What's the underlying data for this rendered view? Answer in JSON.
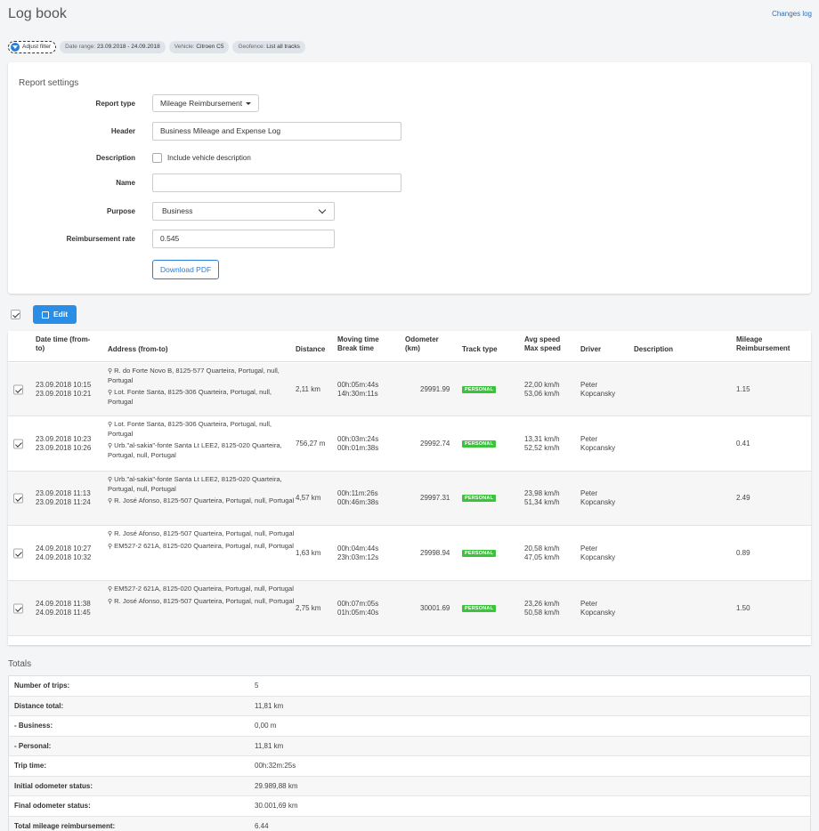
{
  "page": {
    "title": "Log book",
    "changes_log": "Changes log"
  },
  "filters": {
    "adjust": "Adjust filter",
    "date_range_label": "Date range: ",
    "date_range_value": "23.09.2018 - 24.09.2018",
    "vehicle_label": "Vehicle: ",
    "vehicle_value": "Citroen C5",
    "geofence_label": "Geofence: ",
    "geofence_value": "List all tracks"
  },
  "settings": {
    "title": "Report settings",
    "report_type_label": "Report type",
    "report_type_value": "Mileage Reimbursement",
    "header_label": "Header",
    "header_value": "Business Mileage and Expense Log",
    "description_label": "Description",
    "description_checkbox": "Include vehicle description",
    "name_label": "Name",
    "name_value": "",
    "purpose_label": "Purpose",
    "purpose_value": "Business",
    "rate_label": "Reimbursement rate",
    "rate_value": "0.545",
    "download": "Download PDF"
  },
  "toolbar": {
    "edit": "Edit"
  },
  "table": {
    "headers": {
      "date1": "Date time (from-",
      "date2": "to)",
      "address": "Address (from-to)",
      "distance": "Distance",
      "moving1": "Moving time",
      "moving2": "Break time",
      "odo1": "Odometer",
      "odo2": "(km)",
      "track": "Track type",
      "speed1": "Avg speed",
      "speed2": "Max speed",
      "driver": "Driver",
      "description": "Description",
      "mr1": "Mileage",
      "mr2": "Reimbursement"
    },
    "rows": [
      {
        "d1": "23.09.2018 10:15",
        "d2": "23.09.2018 10:21",
        "from": "R. do Forte Novo B, 8125-577 Quarteira, Portugal, null, Portugal",
        "to": "Lot. Fonte Santa, 8125-306 Quarteira, Portugal, null, Portugal",
        "distance": "2,11 km",
        "moving": "00h:05m:44s",
        "break": "14h:30m:11s",
        "odometer": "29991.99",
        "track": "PERSONAL",
        "avg": "22,00 km/h",
        "max": "53,06 km/h",
        "driver1": "Peter",
        "driver2": "Kopcansky",
        "description": "",
        "mr": "1.15"
      },
      {
        "d1": "23.09.2018 10:23",
        "d2": "23.09.2018 10:26",
        "from": "Lot. Fonte Santa, 8125-306 Quarteira, Portugal, null, Portugal",
        "to": "Urb.\"al-sakia\"-fonte Santa Lt LEE2, 8125-020 Quarteira, Portugal, null, Portugal",
        "distance": "756,27 m",
        "moving": "00h:03m:24s",
        "break": "00h:01m:38s",
        "odometer": "29992.74",
        "track": "PERSONAL",
        "avg": "13,31 km/h",
        "max": "52,52 km/h",
        "driver1": "Peter",
        "driver2": "Kopcansky",
        "description": "",
        "mr": "0.41"
      },
      {
        "d1": "23.09.2018 11:13",
        "d2": "23.09.2018 11:24",
        "from": "Urb.\"al-sakia\"-fonte Santa Lt LEE2, 8125-020 Quarteira, Portugal, null, Portugal",
        "to": "R. José Afonso, 8125-507 Quarteira, Portugal, null, Portugal",
        "distance": "4,57 km",
        "moving": "00h:11m:26s",
        "break": "00h:46m:38s",
        "odometer": "29997.31",
        "track": "PERSONAL",
        "avg": "23,98 km/h",
        "max": "51,34 km/h",
        "driver1": "Peter",
        "driver2": "Kopcansky",
        "description": "",
        "mr": "2.49"
      },
      {
        "d1": "24.09.2018 10:27",
        "d2": "24.09.2018 10:32",
        "from": "R. José Afonso, 8125-507 Quarteira, Portugal, null, Portugal",
        "to": "EM527-2 621A, 8125-020 Quarteira, Portugal, null, Portugal",
        "distance": "1,63 km",
        "moving": "00h:04m:44s",
        "break": "23h:03m:12s",
        "odometer": "29998.94",
        "track": "PERSONAL",
        "avg": "20,58 km/h",
        "max": "47,05 km/h",
        "driver1": "Peter",
        "driver2": "Kopcansky",
        "description": "",
        "mr": "0.89"
      },
      {
        "d1": "24.09.2018 11:38",
        "d2": "24.09.2018 11:45",
        "from": "EM527-2 621A, 8125-020 Quarteira, Portugal, null, Portugal",
        "to": "R. José Afonso, 8125-507 Quarteira, Portugal, null, Portugal",
        "distance": "2,75 km",
        "moving": "00h:07m:05s",
        "break": "01h:05m:40s",
        "odometer": "30001.69",
        "track": "PERSONAL",
        "avg": "23,26 km/h",
        "max": "50,58 km/h",
        "driver1": "Peter",
        "driver2": "Kopcansky",
        "description": "",
        "mr": "1.50"
      }
    ]
  },
  "totals": {
    "title": "Totals",
    "rows": [
      {
        "label": "Number of trips:",
        "value": "5"
      },
      {
        "label": "Distance total:",
        "value": "11,81 km"
      },
      {
        "label": "- Business:",
        "value": "0,00 m"
      },
      {
        "label": "- Personal:",
        "value": "11,81 km"
      },
      {
        "label": "Trip time:",
        "value": "00h:32m:25s"
      },
      {
        "label": "Initial odometer status:",
        "value": "29.989,88 km"
      },
      {
        "label": "Final odometer status:",
        "value": "30.001,69 km"
      },
      {
        "label": "Total mileage reimbursement:",
        "value": "6.44"
      }
    ]
  },
  "colors": {
    "accent": "#2a8ee6",
    "link": "#2f6fb1",
    "personal_badge": "#3cc23c"
  }
}
